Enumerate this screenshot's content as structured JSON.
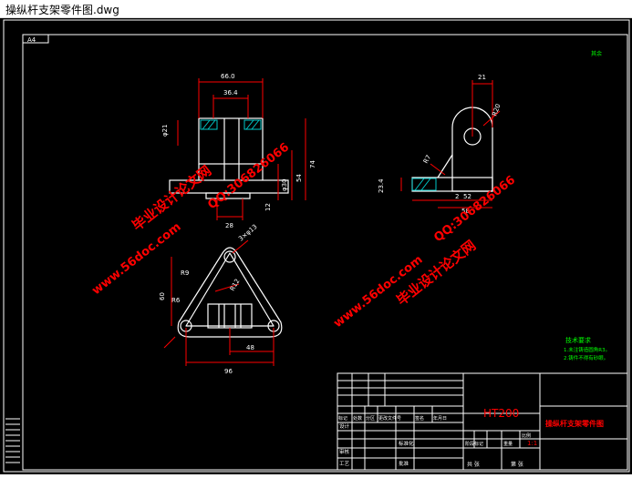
{
  "window": {
    "title": "操纵杆支架零件图.dwg"
  },
  "sheet": {
    "size_label": "A4",
    "corner_mark": "其余"
  },
  "front_view": {
    "dim_overall_width": "66.0",
    "dim_inner_width": "36.4",
    "dim_bottom_width": "28",
    "dim_bore_dia": "φ21",
    "dim_heights": [
      "φ30",
      "54",
      "74"
    ],
    "dim_small": "12"
  },
  "side_view": {
    "dim_top": "21",
    "dim_radius": "R20",
    "dim_small_radius": "R7",
    "dim_gap": "2",
    "dim_left_height": "23.4",
    "dim_base": "52",
    "dim_total": "58"
  },
  "top_view": {
    "dim_r9": "R9",
    "dim_r6": "R6",
    "dim_r12": "R12",
    "dim_h": "60",
    "dim_48": "48",
    "dim_96": "96",
    "dim_hole": "3×φ13"
  },
  "watermarks": [
    "毕业设计论文网",
    "www.56doc.com",
    "QQ:306826066"
  ],
  "tech_notes": {
    "heading": "技术要求",
    "lines": [
      "1.未注铸造圆角R3。",
      "2.铸件不得有砂眼。"
    ]
  },
  "title_block": {
    "material": "HT200",
    "part_name": "操纵杆支架零件图",
    "scale": "1:1",
    "sheet_of": [
      "共 张",
      "第 张"
    ],
    "row_labels": [
      "标记",
      "处数",
      "分区",
      "更改文件号",
      "签名",
      "年月日"
    ],
    "role_labels": [
      "设计",
      "审核",
      "工艺"
    ],
    "col_labels": [
      "阶段标记",
      "重量",
      "比例"
    ],
    "approve": "批准",
    "std": "标准化"
  },
  "colors": {
    "accent": "#ff0000",
    "lines": "#ffffff",
    "green": "#00ff00",
    "hatch": "#00c8c8"
  }
}
